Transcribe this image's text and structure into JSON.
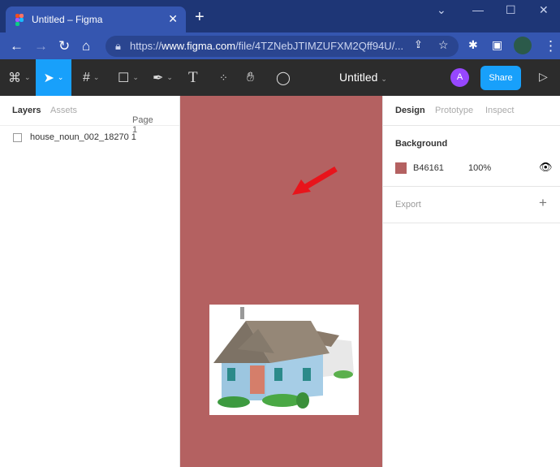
{
  "browser": {
    "tab_title": "Untitled – Figma",
    "url_prefix": "https://",
    "url_host": "www.figma.com",
    "url_path": "/file/4TZNebJTIMZUFXM2Qff94U/..."
  },
  "toolbar": {
    "document_title": "Untitled",
    "avatar_initial": "A",
    "share_label": "Share",
    "selected_tool": "move"
  },
  "left_panel": {
    "tabs": [
      "Layers",
      "Assets"
    ],
    "page": "Page 1",
    "layers": [
      {
        "name": "house_noun_002_18270 1"
      }
    ]
  },
  "right_panel": {
    "tabs": [
      "Design",
      "Prototype",
      "Inspect"
    ],
    "background_heading": "Background",
    "bg_hex": "B46161",
    "bg_opacity": "100%",
    "export_label": "Export"
  },
  "colors": {
    "canvas": "#B46161",
    "accent": "#18A0FB",
    "arrow": "#E8141B"
  }
}
